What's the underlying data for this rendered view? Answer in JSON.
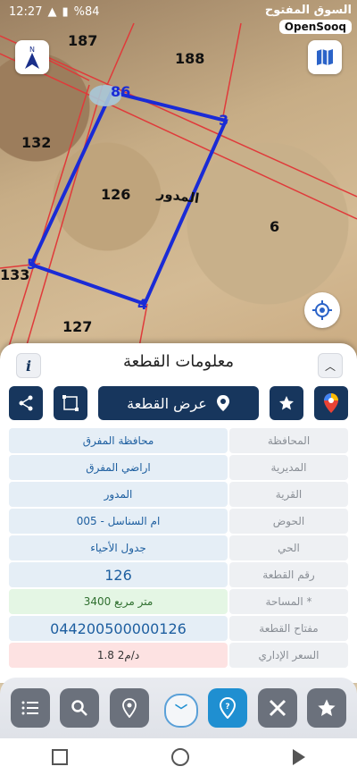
{
  "status": {
    "time": "12:27",
    "battery": "%84"
  },
  "brand": {
    "arabic": "السوق المفتوح",
    "english": "OpenSooq"
  },
  "map": {
    "parcels": [
      {
        "id": "p187",
        "label": "187"
      },
      {
        "id": "p188",
        "label": "188"
      },
      {
        "id": "p132",
        "label": "132"
      },
      {
        "id": "p126",
        "label": "126"
      },
      {
        "id": "p6",
        "label": "6"
      },
      {
        "id": "p133",
        "label": "133"
      },
      {
        "id": "p127",
        "label": "127"
      }
    ],
    "place_name": "المدور",
    "vertices": [
      {
        "label": "86"
      },
      {
        "label": "3"
      },
      {
        "label": "4"
      },
      {
        "label": "5"
      }
    ],
    "icons": [
      "compass-icon",
      "map-icon",
      "locate-icon"
    ]
  },
  "panel": {
    "title": "معلومات القطعة",
    "show_parcel_label": "عرض القطعة",
    "rows": [
      {
        "label": "المحافظة",
        "value": "محافظة المفرق"
      },
      {
        "label": "المديرية",
        "value": "اراضي المفرق"
      },
      {
        "label": "القرية",
        "value": "المدور"
      },
      {
        "label": "الحوض",
        "value": "ام السناسل - 005"
      },
      {
        "label": "الحي",
        "value": "جدول الأحياء"
      },
      {
        "label": "رقم القطعة",
        "value": "126"
      },
      {
        "label": "المساحة *",
        "value": "3400  متر مربع"
      },
      {
        "label": "مفتاح القطعة",
        "value": "044200500000126"
      },
      {
        "label": "السعر الإداري",
        "value": "1.8 د/م2"
      }
    ]
  },
  "colors": {
    "navy": "#17365d",
    "parcel_line": "#1a2bd6",
    "active": "#1f8fd1"
  }
}
